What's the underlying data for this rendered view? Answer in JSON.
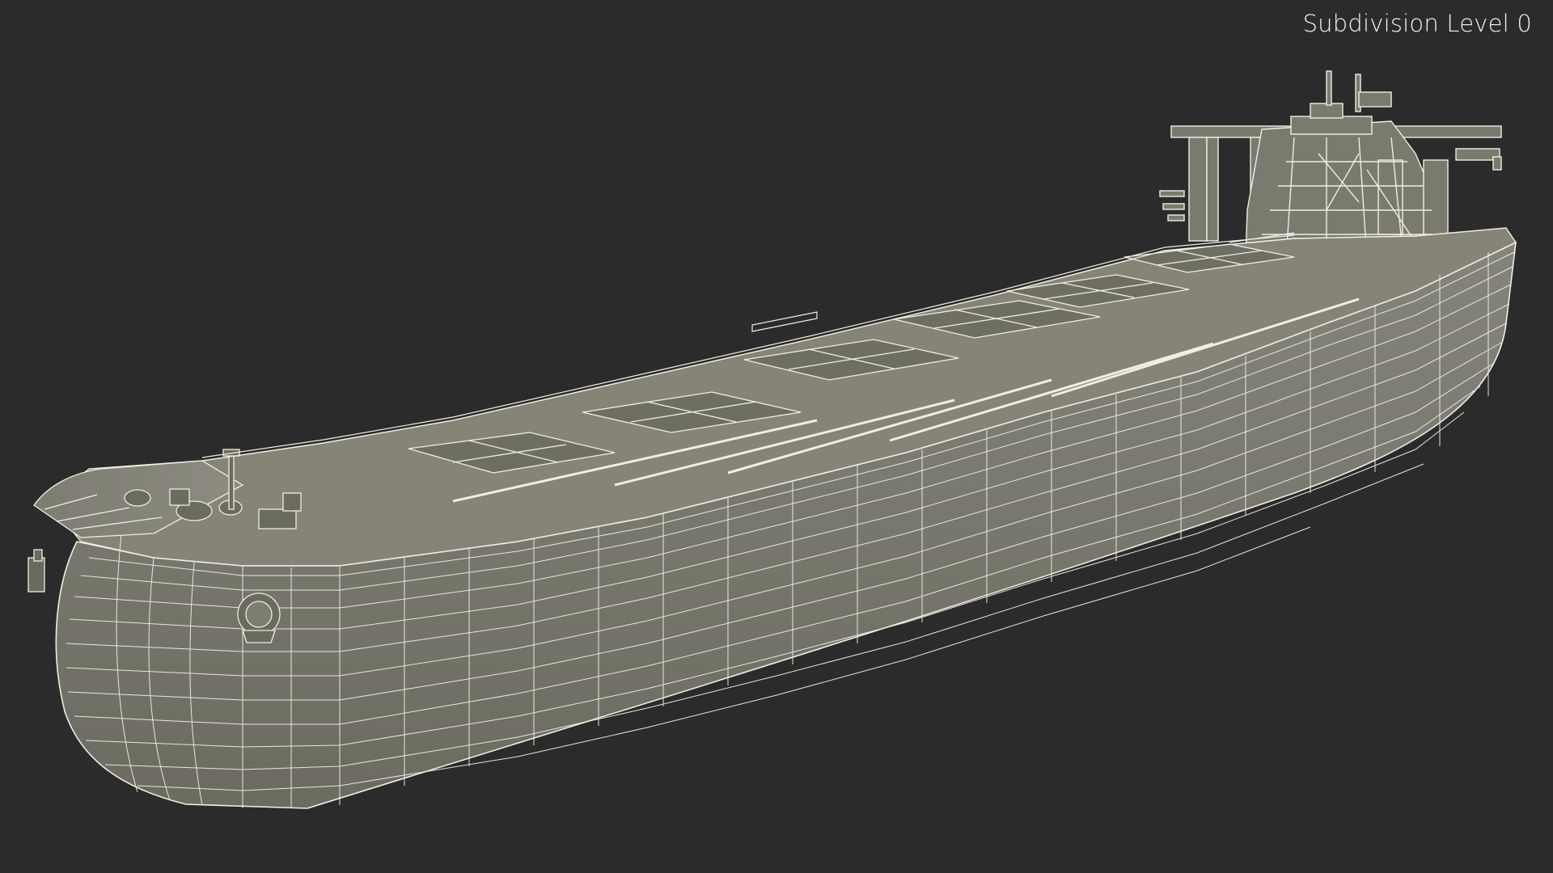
{
  "viewport": {
    "overlay_label": "Subdivision Level 0",
    "colors": {
      "background": "#2b2b2b",
      "surface": "#7a796b",
      "surface_dark": "#5f5e53",
      "wire": "#f0efe6"
    }
  }
}
